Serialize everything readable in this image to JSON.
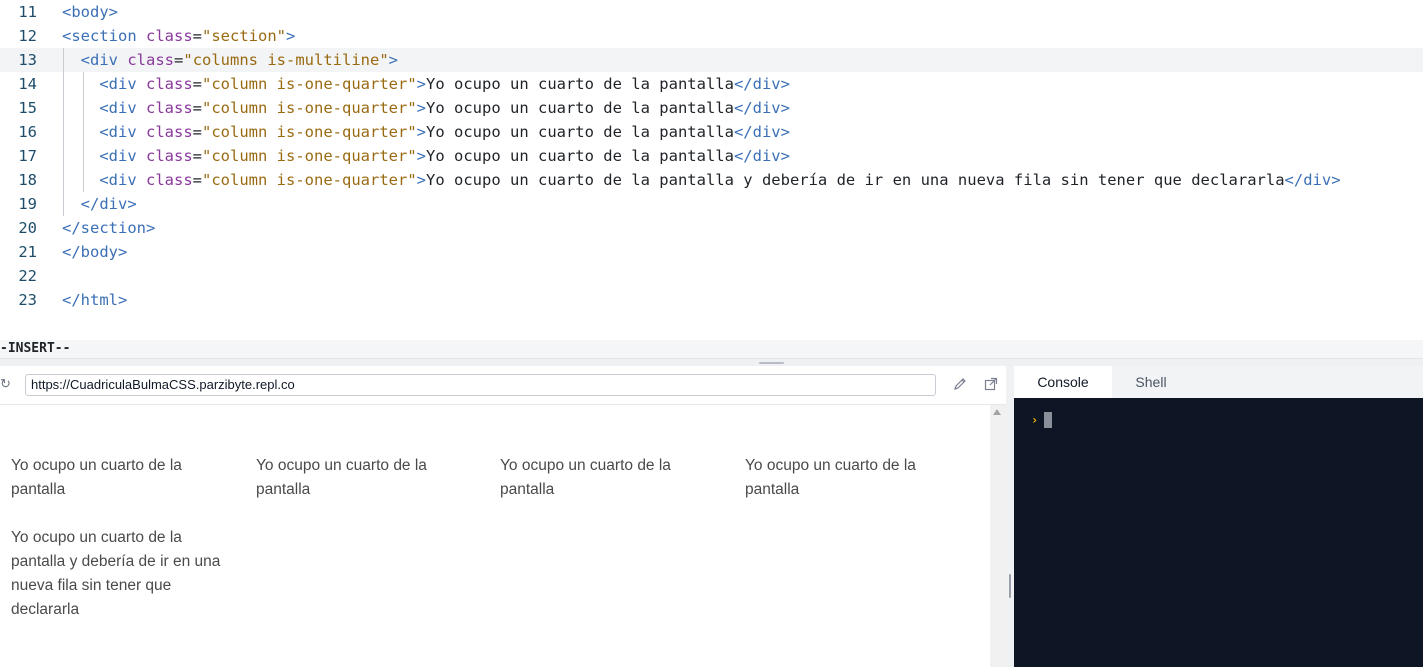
{
  "editor": {
    "lines": [
      {
        "num": "11",
        "indent": "",
        "segments": [
          {
            "t": "tag",
            "v": "<body>"
          }
        ]
      },
      {
        "num": "12",
        "indent": "",
        "segments": [
          {
            "t": "tag",
            "v": "<section"
          },
          {
            "t": "txt",
            "v": " "
          },
          {
            "t": "attr",
            "v": "class"
          },
          {
            "t": "txt",
            "v": "="
          },
          {
            "t": "str",
            "v": "\"section\""
          },
          {
            "t": "tag",
            "v": ">"
          }
        ]
      },
      {
        "num": "13",
        "indent": "  ",
        "segments": [
          {
            "t": "tag",
            "v": "<div"
          },
          {
            "t": "txt",
            "v": " "
          },
          {
            "t": "attr",
            "v": "class"
          },
          {
            "t": "txt",
            "v": "="
          },
          {
            "t": "str",
            "v": "\"columns is-multiline\""
          },
          {
            "t": "tag",
            "v": ">"
          }
        ]
      },
      {
        "num": "14",
        "indent": "    ",
        "segments": [
          {
            "t": "tag",
            "v": "<div"
          },
          {
            "t": "txt",
            "v": " "
          },
          {
            "t": "attr",
            "v": "class"
          },
          {
            "t": "txt",
            "v": "="
          },
          {
            "t": "str",
            "v": "\"column is-one-quarter\""
          },
          {
            "t": "tag",
            "v": ">"
          },
          {
            "t": "txt",
            "v": "Yo ocupo un cuarto de la pantalla"
          },
          {
            "t": "tag",
            "v": "</div>"
          }
        ]
      },
      {
        "num": "15",
        "indent": "    ",
        "segments": [
          {
            "t": "tag",
            "v": "<div"
          },
          {
            "t": "txt",
            "v": " "
          },
          {
            "t": "attr",
            "v": "class"
          },
          {
            "t": "txt",
            "v": "="
          },
          {
            "t": "str",
            "v": "\"column is-one-quarter\""
          },
          {
            "t": "tag",
            "v": ">"
          },
          {
            "t": "txt",
            "v": "Yo ocupo un cuarto de la pantalla"
          },
          {
            "t": "tag",
            "v": "</div>"
          }
        ]
      },
      {
        "num": "16",
        "indent": "    ",
        "segments": [
          {
            "t": "tag",
            "v": "<div"
          },
          {
            "t": "txt",
            "v": " "
          },
          {
            "t": "attr",
            "v": "class"
          },
          {
            "t": "txt",
            "v": "="
          },
          {
            "t": "str",
            "v": "\"column is-one-quarter\""
          },
          {
            "t": "tag",
            "v": ">"
          },
          {
            "t": "txt",
            "v": "Yo ocupo un cuarto de la pantalla"
          },
          {
            "t": "tag",
            "v": "</div>"
          }
        ]
      },
      {
        "num": "17",
        "indent": "    ",
        "segments": [
          {
            "t": "tag",
            "v": "<div"
          },
          {
            "t": "txt",
            "v": " "
          },
          {
            "t": "attr",
            "v": "class"
          },
          {
            "t": "txt",
            "v": "="
          },
          {
            "t": "str",
            "v": "\"column is-one-quarter\""
          },
          {
            "t": "tag",
            "v": ">"
          },
          {
            "t": "txt",
            "v": "Yo ocupo un cuarto de la pantalla"
          },
          {
            "t": "tag",
            "v": "</div>"
          }
        ]
      },
      {
        "num": "18",
        "indent": "    ",
        "segments": [
          {
            "t": "tag",
            "v": "<div"
          },
          {
            "t": "txt",
            "v": " "
          },
          {
            "t": "attr",
            "v": "class"
          },
          {
            "t": "txt",
            "v": "="
          },
          {
            "t": "str",
            "v": "\"column is-one-quarter\""
          },
          {
            "t": "tag",
            "v": ">"
          },
          {
            "t": "txt",
            "v": "Yo ocupo un cuarto de la pantalla y debería de ir en una nueva fila sin tener que declararla"
          },
          {
            "t": "tag",
            "v": "</div>"
          }
        ]
      },
      {
        "num": "19",
        "indent": "  ",
        "segments": [
          {
            "t": "tag",
            "v": "</div>"
          }
        ]
      },
      {
        "num": "20",
        "indent": "",
        "segments": [
          {
            "t": "tag",
            "v": "</section>"
          }
        ]
      },
      {
        "num": "21",
        "indent": "",
        "segments": [
          {
            "t": "tag",
            "v": "</body>"
          }
        ]
      },
      {
        "num": "22",
        "indent": "",
        "segments": []
      },
      {
        "num": "23",
        "indent": "",
        "segments": [
          {
            "t": "tag",
            "v": "</html>"
          }
        ]
      }
    ],
    "active_line": "13",
    "mode": "-INSERT--"
  },
  "webview": {
    "url": "https://CuadriculaBulmaCSS.parzibyte.repl.co",
    "reload_icon": "reload-icon",
    "edit_icon": "pencil-icon",
    "open_icon": "open-in-new-tab-icon",
    "columns": [
      "Yo ocupo un cuarto de la pantalla",
      "Yo ocupo un cuarto de la pantalla",
      "Yo ocupo un cuarto de la pantalla",
      "Yo ocupo un cuarto de la pantalla",
      "Yo ocupo un cuarto de la pantalla y debería de ir en una nueva fila sin tener que declararla"
    ]
  },
  "console": {
    "tabs": [
      "Console",
      "Shell"
    ],
    "active_tab": "Console",
    "prompt": "›"
  },
  "colors": {
    "tag": "#3b6fb6",
    "attribute": "#8a3a9c",
    "string": "#9a6a12",
    "console_bg": "#0e1525",
    "prompt": "#f5b301"
  }
}
